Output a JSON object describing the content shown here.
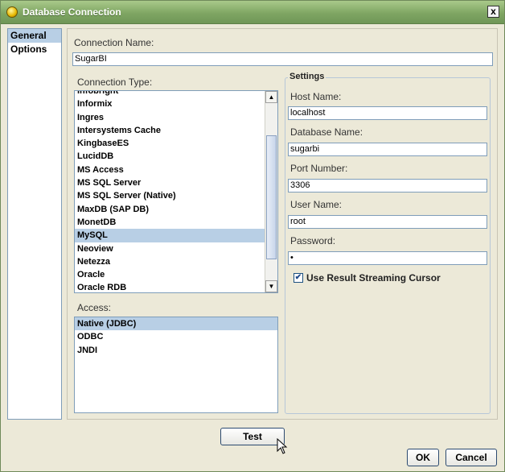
{
  "window": {
    "title": "Database Connection",
    "close_label": "x"
  },
  "nav": {
    "items": [
      {
        "label": "General",
        "selected": true
      },
      {
        "label": "Options",
        "selected": false
      }
    ]
  },
  "connection_name": {
    "label": "Connection Name:",
    "value": "SugarBI"
  },
  "connection_type": {
    "label": "Connection Type:",
    "items": [
      "Infobright",
      "Informix",
      "Ingres",
      "Intersystems Cache",
      "KingbaseES",
      "LucidDB",
      "MS Access",
      "MS SQL Server",
      "MS SQL Server (Native)",
      "MaxDB (SAP DB)",
      "MonetDB",
      "MySQL",
      "Neoview",
      "Netezza",
      "Oracle",
      "Oracle RDB"
    ],
    "selected": "MySQL"
  },
  "access": {
    "label": "Access:",
    "items": [
      "Native (JDBC)",
      "ODBC",
      "JNDI"
    ],
    "selected": "Native (JDBC)"
  },
  "settings": {
    "legend": "Settings",
    "host_name": {
      "label": "Host Name:",
      "value": "localhost"
    },
    "database_name": {
      "label": "Database Name:",
      "value": "sugarbi"
    },
    "port_number": {
      "label": "Port Number:",
      "value": "3306"
    },
    "user_name": {
      "label": "User Name:",
      "value": "root"
    },
    "password": {
      "label": "Password:",
      "value": "•"
    },
    "streaming": {
      "label": "Use Result Streaming Cursor",
      "checked": true
    }
  },
  "buttons": {
    "test": "Test",
    "ok": "OK",
    "cancel": "Cancel"
  },
  "colors": {
    "titlebar": "#7fa663",
    "selection": "#b8cfe5",
    "border": "#7f9db9"
  }
}
